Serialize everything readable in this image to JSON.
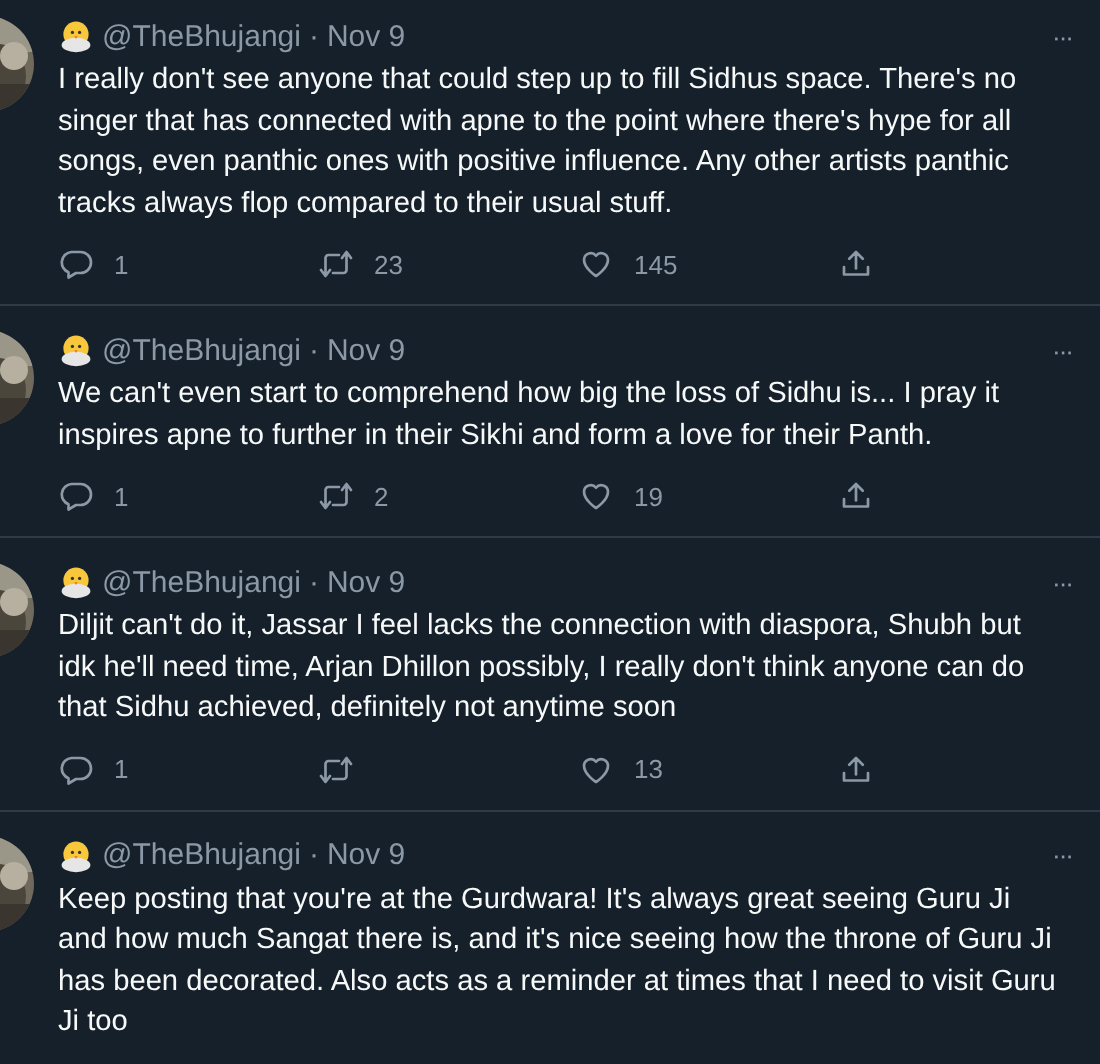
{
  "tweets": [
    {
      "handle": "@TheBhujangi",
      "separator": "·",
      "date": "Nov 9",
      "more": "···",
      "text": "I really don't see anyone that could step up to fill Sidhus space. There's no singer that has connected with apne to the point where there's hype for all songs, even panthic ones with positive influence. Any other artists panthic tracks always flop compared to their usual stuff.",
      "replies": "1",
      "retweets": "23",
      "likes": "145"
    },
    {
      "handle": "@TheBhujangi",
      "separator": "·",
      "date": "Nov 9",
      "more": "···",
      "text": "We can't even start to comprehend how big the loss of Sidhu is... I pray it inspires apne to further in their Sikhi and form a love for their Panth.",
      "replies": "1",
      "retweets": "2",
      "likes": "19"
    },
    {
      "handle": "@TheBhujangi",
      "separator": "·",
      "date": "Nov 9",
      "more": "···",
      "text": "Diljit can't do it, Jassar I feel lacks the connection with diaspora, Shubh but idk he'll need time, Arjan Dhillon possibly, I really don't think anyone can do that Sidhu achieved, definitely not anytime soon",
      "replies": "1",
      "likes": "13"
    },
    {
      "handle": "@TheBhujangi",
      "separator": "·",
      "date": "Nov 9",
      "more": "···",
      "text": "Keep posting that you're at the Gurdwara! It's always great seeing Guru Ji and how much Sangat there is, and it's nice seeing how the throne of Guru Ji has been decorated. Also acts as a reminder at times that I need to visit Guru Ji too"
    }
  ]
}
